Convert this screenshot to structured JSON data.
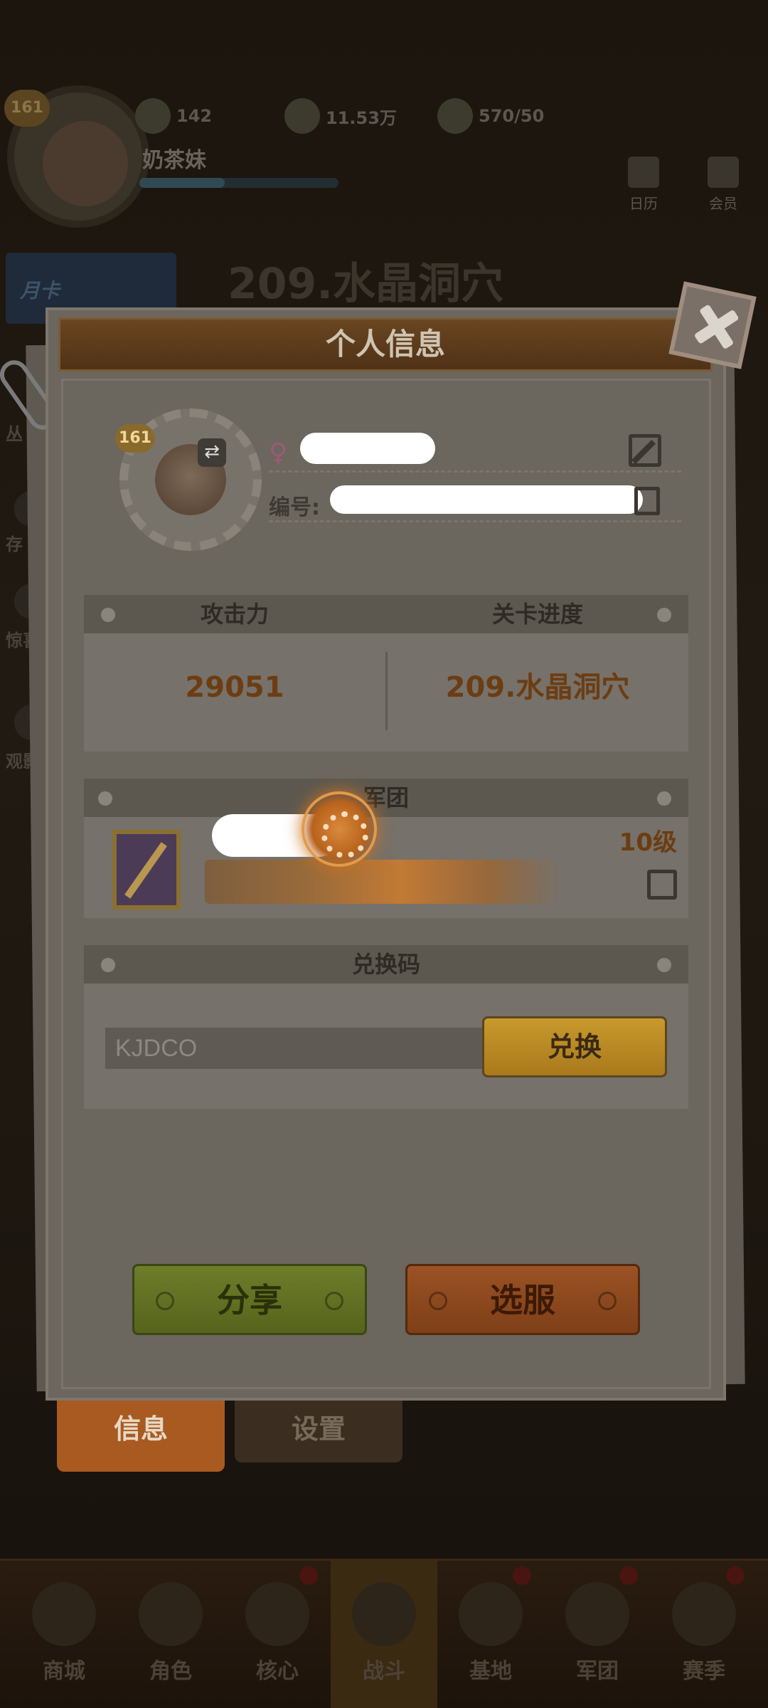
{
  "background": {
    "player": {
      "level": "161",
      "name": "奶茶妹"
    },
    "resources": [
      {
        "icon": "gem-icon",
        "value": "142"
      },
      {
        "icon": "gold-coin-icon",
        "value": "11.53万"
      },
      {
        "icon": "meat-icon",
        "value": "570/50"
      }
    ],
    "top_icons": [
      {
        "label": "日历"
      },
      {
        "label": "会员"
      }
    ],
    "month_card": "月卡",
    "stage_title": "209.水晶洞穴",
    "side_labels": [
      "丛",
      "存",
      "惊喜",
      "观影"
    ],
    "tabs": [
      {
        "label": "信息"
      },
      {
        "label": "设置"
      }
    ],
    "nav": [
      {
        "label": "商城"
      },
      {
        "label": "角色"
      },
      {
        "label": "核心"
      },
      {
        "label": "战斗"
      },
      {
        "label": "基地"
      },
      {
        "label": "军团"
      },
      {
        "label": "赛季"
      }
    ]
  },
  "modal": {
    "title": "个人信息",
    "profile": {
      "level": "161",
      "id_label": "编号:",
      "gender_icon": "female-icon"
    },
    "stats": {
      "attack_label": "攻击力",
      "progress_label": "关卡进度",
      "attack_value": "29051",
      "progress_value": "209.水晶洞穴"
    },
    "guild": {
      "header": "军团",
      "level": "10级"
    },
    "redeem": {
      "header": "兑换码",
      "code_value": "KJDCO",
      "button": "兑换"
    },
    "buttons": {
      "share": "分享",
      "server": "选服"
    }
  },
  "colors": {
    "accent_orange": "#c8731f",
    "share_green": "#6d7d2a",
    "server_orange": "#9b5224",
    "redeem_gold": "#c8992c"
  }
}
